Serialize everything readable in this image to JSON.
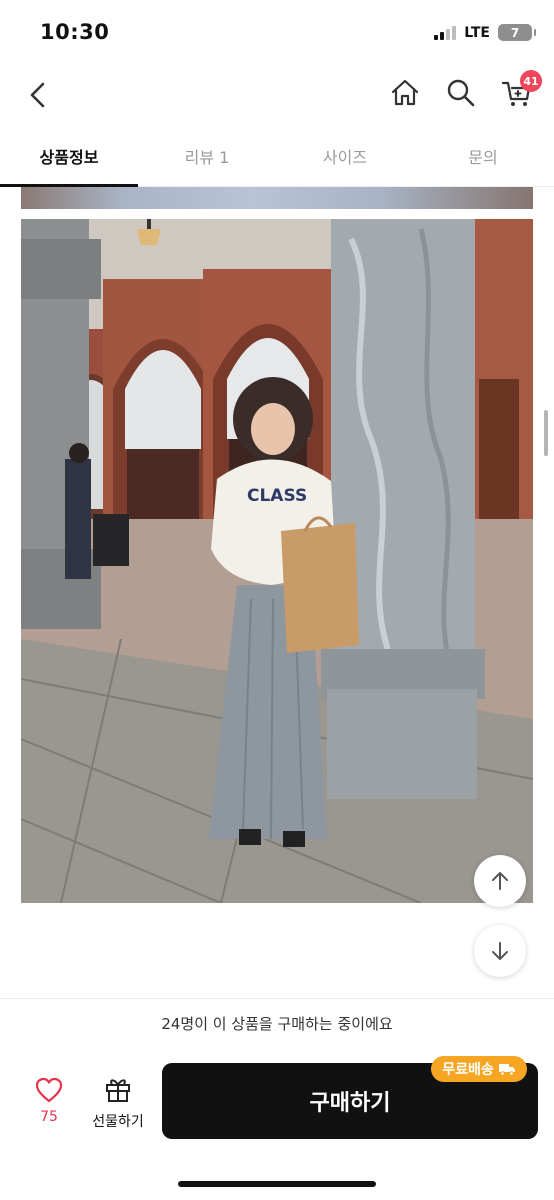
{
  "status_bar": {
    "time": "10:30",
    "network": "LTE",
    "battery": "7"
  },
  "header": {
    "cart_count": "41"
  },
  "tabs": [
    {
      "label": "상품정보",
      "active": true
    },
    {
      "label": "리뷰 1",
      "active": false
    },
    {
      "label": "사이즈",
      "active": false
    },
    {
      "label": "문의",
      "active": false
    }
  ],
  "photo_sweatshirt_print": "CLASS",
  "bottom": {
    "buyers_text": "24명이 이 상품을 구매하는 중이에요",
    "like_count": "75",
    "gift_label": "선물하기",
    "buy_label": "구매하기",
    "shipping_badge": "무료배송"
  },
  "colors": {
    "accent_red": "#f0455a",
    "like_red": "#e5334c",
    "buy_button": "#111111",
    "shipping_badge": "#f6a623"
  },
  "icons": [
    "back-icon",
    "home-icon",
    "search-icon",
    "cart-icon",
    "heart-icon",
    "gift-icon",
    "arrow-up-icon",
    "arrow-down-icon",
    "truck-icon"
  ]
}
